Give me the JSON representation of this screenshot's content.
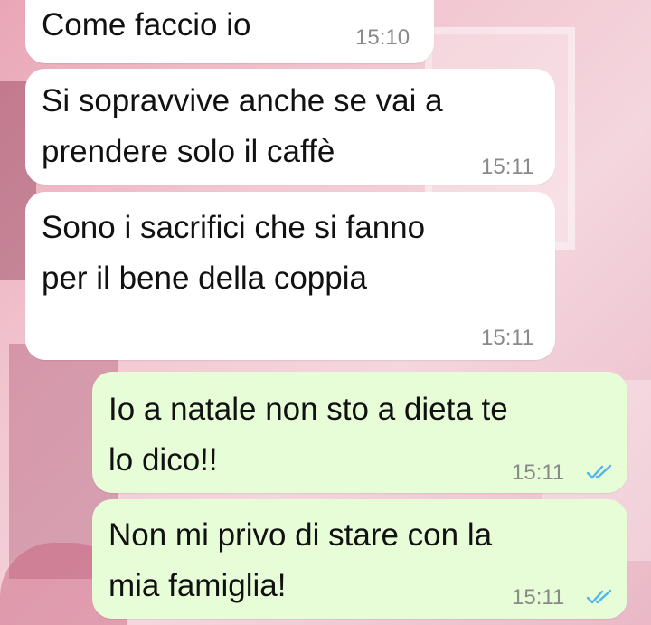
{
  "chat": {
    "messages": [
      {
        "direction": "incoming",
        "text": "Come faccio io",
        "time": "15:10"
      },
      {
        "direction": "incoming",
        "text": "Si sopravvive anche se vai a\nprendere solo il caffè",
        "time": "15:11"
      },
      {
        "direction": "incoming",
        "text": "Sono i sacrifici che si fanno\nper il bene della coppia",
        "time": "15:11"
      },
      {
        "direction": "outgoing",
        "text": "Io a natale non sto a dieta te\nlo dico!!",
        "time": "15:11",
        "status": "read"
      },
      {
        "direction": "outgoing",
        "text": "Non mi privo di stare con la\nmia famiglia!",
        "time": "15:11",
        "status": "read"
      }
    ]
  },
  "colors": {
    "incoming_bubble": "#ffffff",
    "outgoing_bubble": "#e7fdd8",
    "read_ticks": "#4fb6ec",
    "timestamp": "#8a8a8a"
  },
  "icons": {
    "read_receipt": "double-check-icon"
  }
}
